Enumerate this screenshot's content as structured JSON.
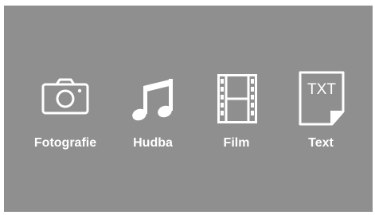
{
  "menu": {
    "items": [
      {
        "label": "Fotografie",
        "icon": "camera-icon"
      },
      {
        "label": "Hudba",
        "icon": "music-note-icon"
      },
      {
        "label": "Film",
        "icon": "film-strip-icon"
      },
      {
        "label": "Text",
        "icon": "text-file-icon",
        "icon_text": "TXT"
      }
    ]
  },
  "colors": {
    "background": "#8f8f8f",
    "foreground": "#ffffff"
  }
}
